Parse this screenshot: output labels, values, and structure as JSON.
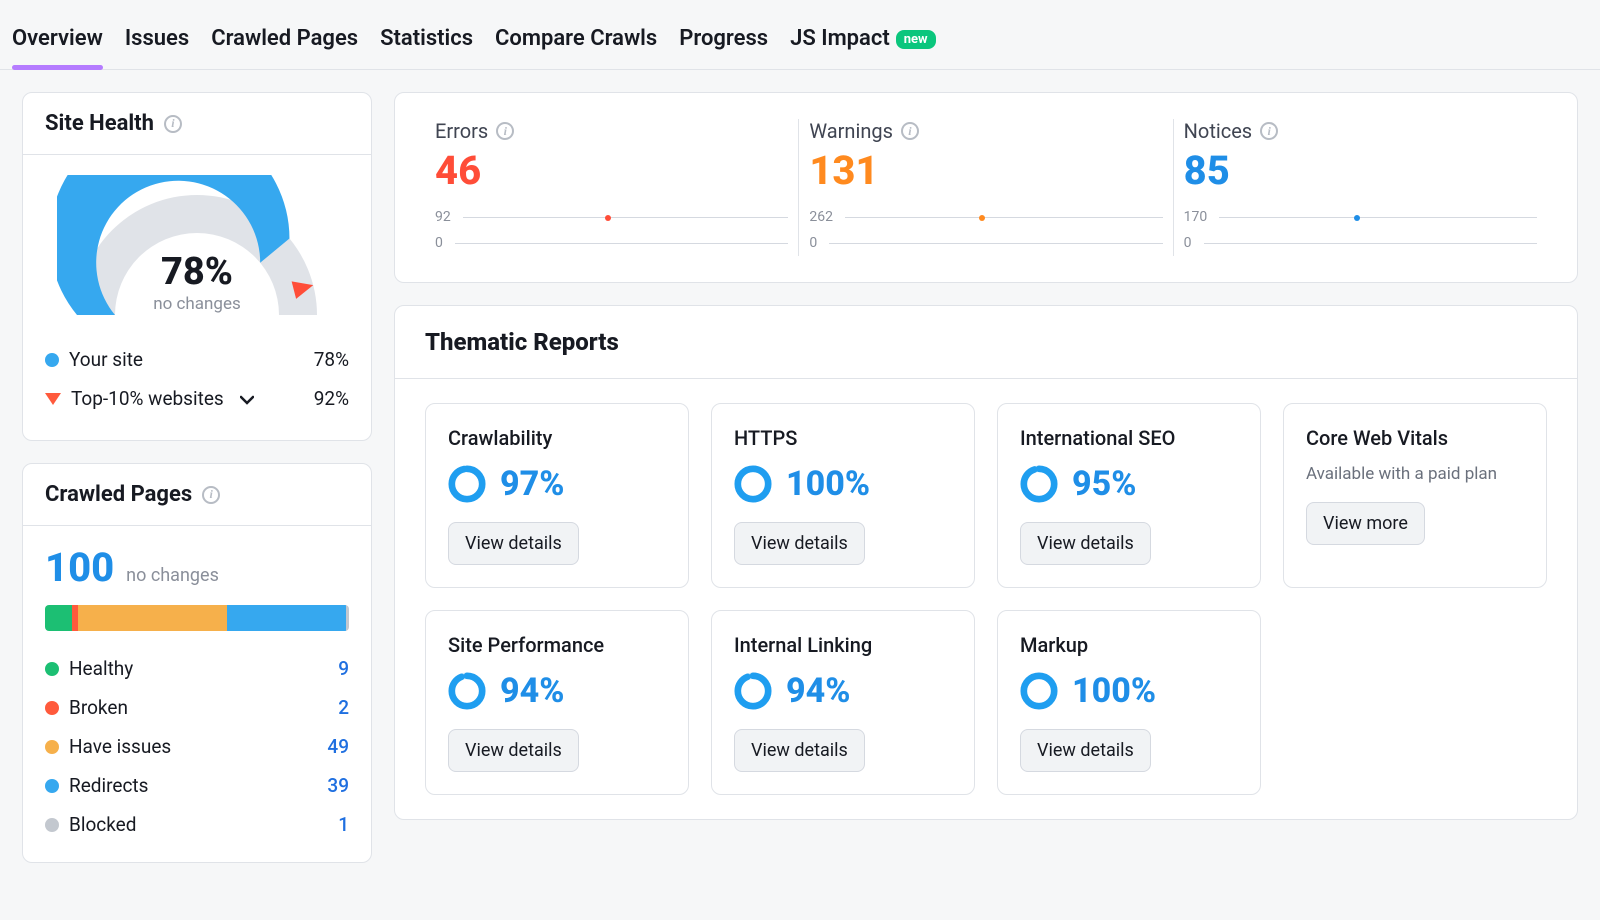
{
  "tabs": [
    {
      "label": "Overview",
      "active": true
    },
    {
      "label": "Issues"
    },
    {
      "label": "Crawled Pages"
    },
    {
      "label": "Statistics"
    },
    {
      "label": "Compare Crawls"
    },
    {
      "label": "Progress"
    },
    {
      "label": "JS Impact",
      "badge": "new"
    }
  ],
  "site_health": {
    "title": "Site Health",
    "percent_label": "78%",
    "subtext": "no changes",
    "your_site_label": "Your site",
    "your_site_value": "78%",
    "top10_label": "Top-10% websites",
    "top10_value": "92%"
  },
  "crawled_pages": {
    "title": "Crawled Pages",
    "total": "100",
    "subtext": "no changes",
    "segments": [
      {
        "key": "healthy",
        "color": "#1cbf73",
        "pct": 9
      },
      {
        "key": "broken",
        "color": "#ff5a3c",
        "pct": 2
      },
      {
        "key": "have_issues",
        "color": "#f6b04b",
        "pct": 49
      },
      {
        "key": "redirects",
        "color": "#36a8ef",
        "pct": 39
      },
      {
        "key": "blocked",
        "color": "#c3c8cf",
        "pct": 1
      }
    ],
    "rows": [
      {
        "label": "Healthy",
        "color": "#1cbf73",
        "count": "9"
      },
      {
        "label": "Broken",
        "color": "#ff5a3c",
        "count": "2"
      },
      {
        "label": "Have issues",
        "color": "#f6b04b",
        "count": "49"
      },
      {
        "label": "Redirects",
        "color": "#36a8ef",
        "count": "39"
      },
      {
        "label": "Blocked",
        "color": "#c3c8cf",
        "count": "1"
      }
    ]
  },
  "top_metrics": [
    {
      "title": "Errors",
      "value": "46",
      "color": "#ff4d38",
      "axis_top": "92",
      "axis_bot": "0",
      "dot_color": "#ff4d38"
    },
    {
      "title": "Warnings",
      "value": "131",
      "color": "#ff8a1f",
      "axis_top": "262",
      "axis_bot": "0",
      "dot_color": "#ff8a1f"
    },
    {
      "title": "Notices",
      "value": "85",
      "color": "#1f8ee7",
      "axis_top": "170",
      "axis_bot": "0",
      "dot_color": "#1f8ee7"
    }
  ],
  "thematic": {
    "title": "Thematic Reports",
    "button_label": "View details",
    "button_more_label": "View more",
    "tiles": [
      {
        "title": "Crawlability",
        "pct": "97%",
        "ring_pct": 97
      },
      {
        "title": "HTTPS",
        "pct": "100%",
        "ring_pct": 100
      },
      {
        "title": "International SEO",
        "pct": "95%",
        "ring_pct": 95
      },
      {
        "title": "Core Web Vitals",
        "locked": true,
        "note": "Available with a paid plan"
      },
      {
        "title": "Site Performance",
        "pct": "94%",
        "ring_pct": 94
      },
      {
        "title": "Internal Linking",
        "pct": "94%",
        "ring_pct": 94
      },
      {
        "title": "Markup",
        "pct": "100%",
        "ring_pct": 100
      }
    ]
  },
  "chart_data": {
    "site_health_gauge": {
      "type": "gauge",
      "value": 78,
      "range": [
        0,
        100
      ],
      "benchmark_top10": 92,
      "title": "Site Health"
    },
    "crawled_pages_breakdown": {
      "type": "stacked-bar",
      "total": 100,
      "categories": [
        "Healthy",
        "Broken",
        "Have issues",
        "Redirects",
        "Blocked"
      ],
      "values": [
        9,
        2,
        49,
        39,
        1
      ]
    },
    "top_metrics_sparklines": [
      {
        "name": "Errors",
        "current": 46,
        "ylim": [
          0,
          92
        ],
        "points": [
          46
        ]
      },
      {
        "name": "Warnings",
        "current": 131,
        "ylim": [
          0,
          262
        ],
        "points": [
          131
        ]
      },
      {
        "name": "Notices",
        "current": 85,
        "ylim": [
          0,
          170
        ],
        "points": [
          85
        ]
      }
    ],
    "thematic_scores": {
      "type": "donut-small-multiples",
      "categories": [
        "Crawlability",
        "HTTPS",
        "International SEO",
        "Site Performance",
        "Internal Linking",
        "Markup"
      ],
      "values": [
        97,
        100,
        95,
        94,
        94,
        100
      ],
      "range": [
        0,
        100
      ]
    }
  }
}
